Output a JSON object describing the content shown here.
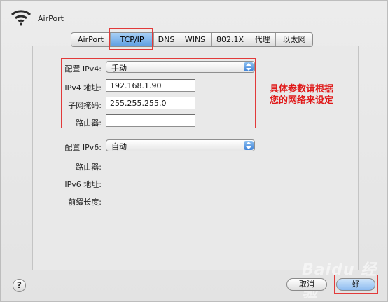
{
  "app": {
    "title": "AirPort"
  },
  "tabs": [
    {
      "label": "AirPort",
      "active": false
    },
    {
      "label": "TCP/IP",
      "active": true
    },
    {
      "label": "DNS",
      "active": false
    },
    {
      "label": "WINS",
      "active": false
    },
    {
      "label": "802.1X",
      "active": false
    },
    {
      "label": "代理",
      "active": false
    },
    {
      "label": "以太网",
      "active": false
    }
  ],
  "ipv4": {
    "config_label": "配置 IPv4:",
    "config_value": "手动",
    "address_label": "IPv4 地址:",
    "address_value": "192.168.1.90",
    "subnet_label": "子网掩码:",
    "subnet_value": "255.255.255.0",
    "router_label": "路由器:",
    "router_value": ""
  },
  "ipv6": {
    "config_label": "配置 IPv6:",
    "config_value": "自动",
    "router_label": "路由器:",
    "address_label": "IPv6 地址:",
    "prefix_label": "前缀长度:"
  },
  "annotation": {
    "line1": "具体参数请根据",
    "line2": "您的网络来设定"
  },
  "footer": {
    "help_label": "?",
    "cancel_label": "取消",
    "ok_label": "好"
  },
  "watermark": "Baidu 经验",
  "colors": {
    "accent_blue": "#5f9fe3",
    "annotation_red": "#e01a1a"
  }
}
